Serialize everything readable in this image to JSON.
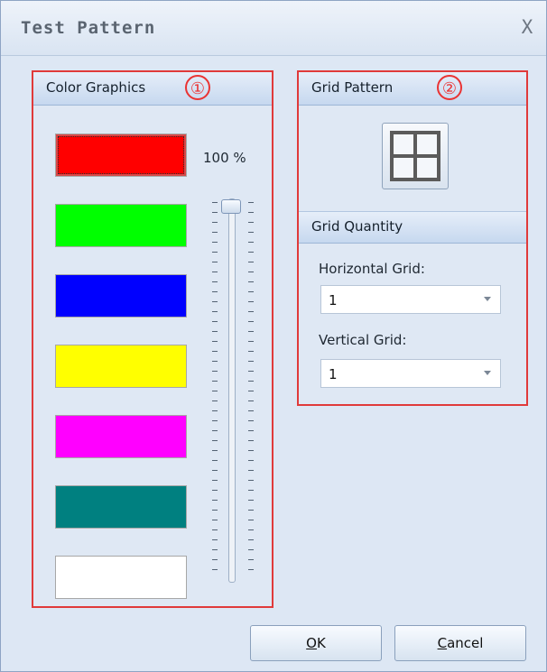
{
  "window": {
    "title": "Test Pattern",
    "close_label": "X"
  },
  "color_graphics": {
    "title": "Color Graphics",
    "badge": "①",
    "percent_label": "100 %",
    "swatches": [
      {
        "color": "#ff0000",
        "selected": true
      },
      {
        "color": "#00ff00",
        "selected": false
      },
      {
        "color": "#0000ff",
        "selected": false
      },
      {
        "color": "#ffff00",
        "selected": false
      },
      {
        "color": "#ff00ff",
        "selected": false
      },
      {
        "color": "#008080",
        "selected": false
      },
      {
        "color": "#ffffff",
        "selected": false
      }
    ]
  },
  "grid_pattern": {
    "title": "Grid Pattern",
    "badge": "②",
    "button_icon": "grid-icon"
  },
  "grid_quantity": {
    "title": "Grid Quantity",
    "horizontal_label": "Horizontal Grid:",
    "horizontal_value": "1",
    "vertical_label": "Vertical Grid:",
    "vertical_value": "1"
  },
  "buttons": {
    "ok": "OK",
    "cancel": "Cancel"
  },
  "colors": {
    "highlight_red": "#e03a3a",
    "panel_bg": "#dfe8f4"
  }
}
